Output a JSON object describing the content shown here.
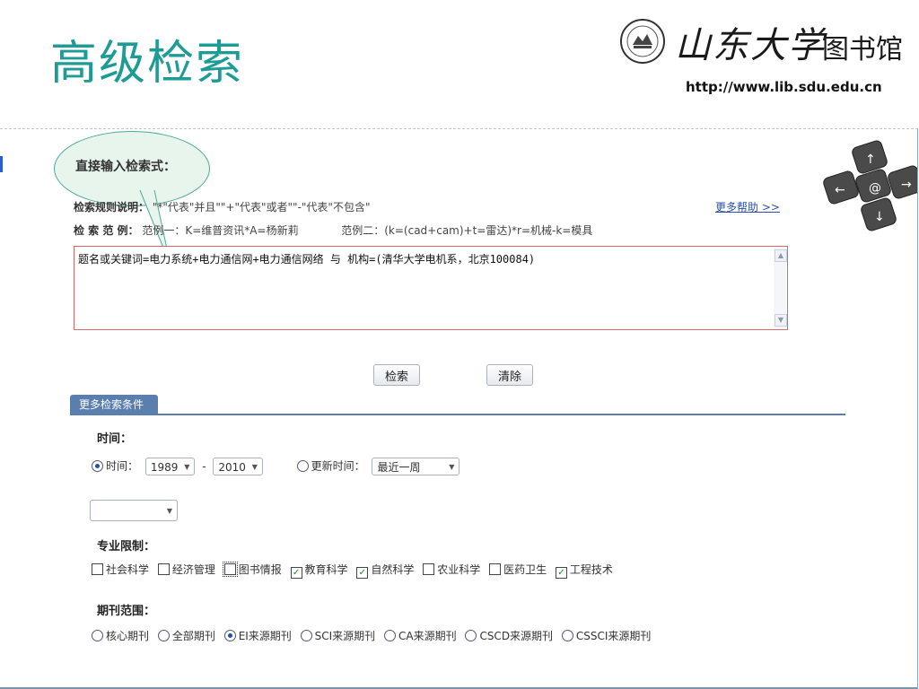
{
  "slide": {
    "title": "高级检索",
    "brand_calligraphy": "山东大学",
    "brand_library": "图书馆",
    "brand_url": "http://www.lib.sdu.edu.cn"
  },
  "search": {
    "direct_input_label": "直接输入检索式：",
    "rules_label": "检索规则说明：",
    "rules_text": "\"*\"代表\"并且\"\"+\"代表\"或者\"\"-\"代表\"不包含\"",
    "examples_label": "检 索 范 例：",
    "example1": "范例一：K=维普资讯*A=杨新莉",
    "example2": "范例二：(k=(cad+cam)+t=雷达)*r=机械-k=模具",
    "help_link": "更多帮助 >>",
    "query": "题名或关键词=电力系统+电力通信网+电力通信网络 与 机构=(清华大学电机系，北京100084)",
    "search_button": "检索",
    "clear_button": "清除"
  },
  "more": {
    "tab_label": "更多检索条件",
    "time_title": "时间：",
    "time_radio_label": "时间：",
    "year_from": "1989",
    "year_sep": "-",
    "year_to": "2010",
    "update_radio_label": "更新时间：",
    "update_value": "最近一周",
    "extra_select_value": "",
    "subject_title": "专业限制：",
    "subjects": [
      {
        "label": "社会科学",
        "checked": false
      },
      {
        "label": "经济管理",
        "checked": false
      },
      {
        "label": "图书情报",
        "checked": false
      },
      {
        "label": "教育科学",
        "checked": true
      },
      {
        "label": "自然科学",
        "checked": true
      },
      {
        "label": "农业科学",
        "checked": false
      },
      {
        "label": "医药卫生",
        "checked": false
      },
      {
        "label": "工程技术",
        "checked": true
      }
    ],
    "journal_title": "期刊范围：",
    "journals": [
      {
        "label": "核心期刊",
        "selected": false
      },
      {
        "label": "全部期刊",
        "selected": false
      },
      {
        "label": "EI来源期刊",
        "selected": true
      },
      {
        "label": "SCI来源期刊",
        "selected": false
      },
      {
        "label": "CA来源期刊",
        "selected": false
      },
      {
        "label": "CSCD来源期刊",
        "selected": false
      },
      {
        "label": "CSSCI来源期刊",
        "selected": false
      }
    ]
  },
  "colors": {
    "title": "#1d9c95",
    "tab": "#5a7fae",
    "link": "#2b52a8",
    "query_border": "#dd6666"
  }
}
